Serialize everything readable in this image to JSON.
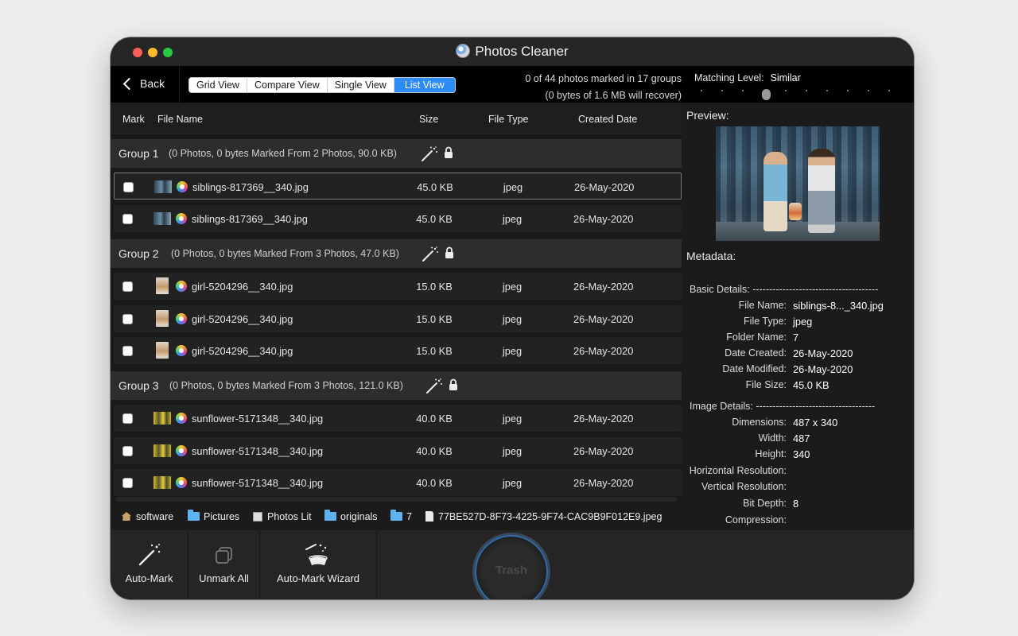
{
  "app": {
    "title": "Photos Cleaner"
  },
  "toolbar": {
    "back_label": "Back",
    "views": [
      "Grid View",
      "Compare View",
      "Single View",
      "List View"
    ],
    "active_view": "List View",
    "summary_line1": "0 of 44 photos marked in 17 groups",
    "summary_line2": "(0 bytes of 1.6 MB will recover)",
    "matching_label": "Matching Level:",
    "matching_value": "Similar"
  },
  "table": {
    "headers": {
      "mark": "Mark",
      "file_name": "File Name",
      "size": "Size",
      "file_type": "File Type",
      "created_date": "Created Date"
    }
  },
  "groups": [
    {
      "name": "Group 1",
      "info": "(0 Photos, 0 bytes Marked From 2 Photos, 90.0 KB)",
      "files": [
        {
          "name": "siblings-817369__340.jpg",
          "size": "45.0 KB",
          "type": "jpeg",
          "date": "26-May-2020",
          "thumb": "kids",
          "selected": true
        },
        {
          "name": "siblings-817369__340.jpg",
          "size": "45.0 KB",
          "type": "jpeg",
          "date": "26-May-2020",
          "thumb": "kids"
        }
      ]
    },
    {
      "name": "Group 2",
      "info": "(0 Photos, 0 bytes Marked From 3 Photos, 47.0 KB)",
      "files": [
        {
          "name": "girl-5204296__340.jpg",
          "size": "15.0 KB",
          "type": "jpeg",
          "date": "26-May-2020",
          "thumb": "girl"
        },
        {
          "name": "girl-5204296__340.jpg",
          "size": "15.0 KB",
          "type": "jpeg",
          "date": "26-May-2020",
          "thumb": "girl"
        },
        {
          "name": "girl-5204296__340.jpg",
          "size": "15.0 KB",
          "type": "jpeg",
          "date": "26-May-2020",
          "thumb": "girl"
        }
      ]
    },
    {
      "name": "Group 3",
      "info": "(0 Photos, 0 bytes Marked From 3 Photos, 121.0 KB)",
      "files": [
        {
          "name": "sunflower-5171348__340.jpg",
          "size": "40.0 KB",
          "type": "jpeg",
          "date": "26-May-2020",
          "thumb": "sun"
        },
        {
          "name": "sunflower-5171348__340.jpg",
          "size": "40.0 KB",
          "type": "jpeg",
          "date": "26-May-2020",
          "thumb": "sun"
        },
        {
          "name": "sunflower-5171348__340.jpg",
          "size": "40.0 KB",
          "type": "jpeg",
          "date": "26-May-2020",
          "thumb": "sun"
        }
      ]
    }
  ],
  "pathbar": [
    {
      "label": "software",
      "icon": "home-icon"
    },
    {
      "label": "Pictures",
      "icon": "folder-icon"
    },
    {
      "label": "Photos Lit",
      "icon": "photos-library-icon"
    },
    {
      "label": "originals",
      "icon": "folder-icon"
    },
    {
      "label": "7",
      "icon": "folder-icon"
    },
    {
      "label": "77BE527D-8F73-4225-9F74-CAC9B9F012E9.jpeg",
      "icon": "file-icon"
    }
  ],
  "preview": {
    "label": "Preview:",
    "metadata_label": "Metadata:",
    "basic_header": "Basic Details: --------------------------------------",
    "basic": [
      {
        "key": "File Name:",
        "value": "siblings-8..._340.jpg"
      },
      {
        "key": "File Type:",
        "value": "jpeg"
      },
      {
        "key": "Folder Name:",
        "value": "7"
      },
      {
        "key": "Date Created:",
        "value": "26-May-2020"
      },
      {
        "key": "Date Modified:",
        "value": "26-May-2020"
      },
      {
        "key": "File Size:",
        "value": "45.0 KB"
      }
    ],
    "image_header": "Image Details: ------------------------------------",
    "image": [
      {
        "key": "Dimensions:",
        "value": "487 x 340"
      },
      {
        "key": "Width:",
        "value": "487"
      },
      {
        "key": "Height:",
        "value": "340"
      },
      {
        "key": "Horizontal Resolution:",
        "value": ""
      },
      {
        "key": "Vertical Resolution:",
        "value": ""
      },
      {
        "key": "Bit Depth:",
        "value": "8"
      },
      {
        "key": "Compression:",
        "value": ""
      }
    ]
  },
  "bottombar": {
    "auto_mark": "Auto-Mark",
    "unmark_all": "Unmark All",
    "auto_mark_wizard": "Auto-Mark Wizard",
    "trash": "Trash"
  },
  "colors": {
    "accent": "#2d8bf6",
    "background": "#1e1e1e",
    "toolbar": "#000000"
  }
}
